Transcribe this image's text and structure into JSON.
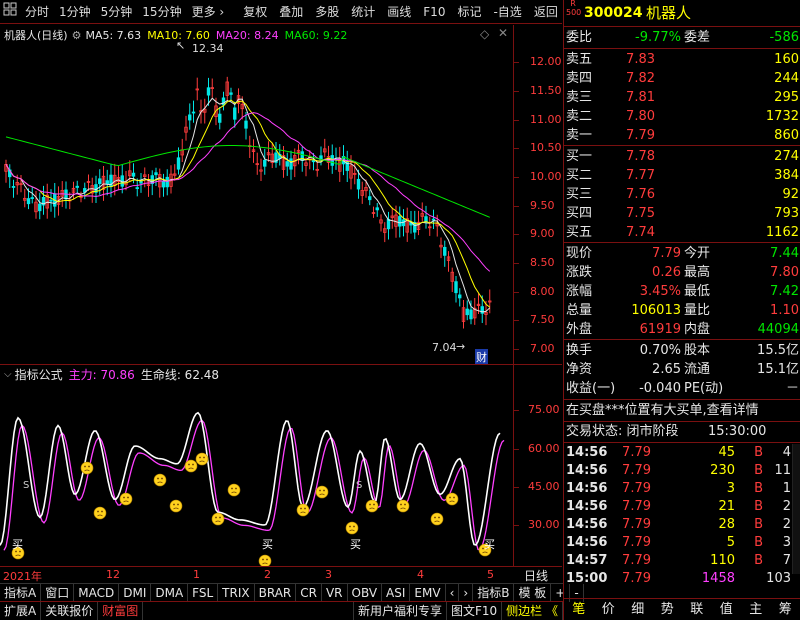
{
  "toolbar": {
    "left_items": [
      "分时",
      "1分钟",
      "5分钟",
      "15分钟",
      "更多 ›"
    ],
    "right_items": [
      "复权",
      "叠加",
      "多股",
      "统计",
      "画线",
      "F10",
      "标记",
      "-自选",
      "返回"
    ]
  },
  "stock": {
    "code": "300024",
    "name": "机器人",
    "badge_top": "R",
    "badge_bottom": "500"
  },
  "kline_header": {
    "title": "机器人(日线)",
    "ma5": "MA5: 7.63",
    "ma10": "MA10: 7.60",
    "ma20": "MA20: 8.24",
    "ma60": "MA60: 9.22",
    "high_label": "12.34",
    "low_label": "7.04",
    "cai_label": "财"
  },
  "price_axis": [
    "12.00",
    "11.50",
    "11.00",
    "10.50",
    "10.00",
    "9.50",
    "9.00",
    "8.50",
    "8.00",
    "7.50",
    "7.00"
  ],
  "indicator_header": {
    "name": "指标公式",
    "main": "主力: 70.86",
    "life": "生命线: 62.48"
  },
  "indicator_axis": [
    "75.00",
    "60.00",
    "45.00",
    "30.00"
  ],
  "indicator_markers": {
    "buy": "买",
    "sell": "S"
  },
  "date_axis": {
    "labels": [
      "2021年",
      "12",
      "1",
      "2",
      "3",
      "4",
      "5"
    ],
    "mode": "日线"
  },
  "bottom_tabs": [
    "指标A",
    "窗口",
    "MACD",
    "DMI",
    "DMA",
    "FSL",
    "TRIX",
    "BRAR",
    "CR",
    "VR",
    "OBV",
    "ASI",
    "EMV",
    "‹",
    "›",
    "指标B",
    "模 板",
    "+",
    "-"
  ],
  "footer_left": [
    "扩展A",
    "关联报价",
    "财富图"
  ],
  "footer_mid": [
    "新用户福利专享",
    "图文F10",
    "侧边栏 《"
  ],
  "quote": {
    "weibi_label": "委比",
    "weibi": "-9.77%",
    "weicha_label": "委差",
    "weicha": "-586",
    "asks": [
      {
        "label": "卖五",
        "price": "7.83",
        "vol": "160"
      },
      {
        "label": "卖四",
        "price": "7.82",
        "vol": "244"
      },
      {
        "label": "卖三",
        "price": "7.81",
        "vol": "295"
      },
      {
        "label": "卖二",
        "price": "7.80",
        "vol": "1732"
      },
      {
        "label": "卖一",
        "price": "7.79",
        "vol": "860"
      }
    ],
    "bids": [
      {
        "label": "买一",
        "price": "7.78",
        "vol": "274"
      },
      {
        "label": "买二",
        "price": "7.77",
        "vol": "384"
      },
      {
        "label": "买三",
        "price": "7.76",
        "vol": "92"
      },
      {
        "label": "买四",
        "price": "7.75",
        "vol": "793"
      },
      {
        "label": "买五",
        "price": "7.74",
        "vol": "1162"
      }
    ],
    "stats": [
      {
        "l1": "现价",
        "v1": "7.79",
        "c1": "red",
        "l2": "今开",
        "v2": "7.44",
        "c2": "green"
      },
      {
        "l1": "涨跌",
        "v1": "0.26",
        "c1": "red",
        "l2": "最高",
        "v2": "7.80",
        "c2": "red"
      },
      {
        "l1": "涨幅",
        "v1": "3.45%",
        "c1": "red",
        "l2": "最低",
        "v2": "7.42",
        "c2": "green"
      },
      {
        "l1": "总量",
        "v1": "106013",
        "c1": "yellow",
        "l2": "量比",
        "v2": "1.10",
        "c2": "red"
      },
      {
        "l1": "外盘",
        "v1": "61919",
        "c1": "red",
        "l2": "内盘",
        "v2": "44094",
        "c2": "green"
      }
    ],
    "stats2": [
      {
        "l1": "换手",
        "v1": "0.70%",
        "l2": "股本",
        "v2": "15.5亿"
      },
      {
        "l1": "净资",
        "v1": "2.65",
        "l2": "流通",
        "v2": "15.1亿"
      },
      {
        "l1": "收益(一)",
        "v1": "-0.040",
        "l2": "PE(动)",
        "v2": "－"
      }
    ],
    "notice": "在买盘***位置有大买单,查看详情",
    "status_label": "交易状态: 闭市阶段",
    "status_time": "15:30:00",
    "ticks": [
      {
        "t": "14:56",
        "p": "7.79",
        "v": "45",
        "d": "B",
        "n": "4"
      },
      {
        "t": "14:56",
        "p": "7.79",
        "v": "230",
        "d": "B",
        "n": "11"
      },
      {
        "t": "14:56",
        "p": "7.79",
        "v": "3",
        "d": "B",
        "n": "1"
      },
      {
        "t": "14:56",
        "p": "7.79",
        "v": "21",
        "d": "B",
        "n": "2"
      },
      {
        "t": "14:56",
        "p": "7.79",
        "v": "28",
        "d": "B",
        "n": "2"
      },
      {
        "t": "14:56",
        "p": "7.79",
        "v": "5",
        "d": "B",
        "n": "3"
      },
      {
        "t": "14:57",
        "p": "7.79",
        "v": "110",
        "d": "B",
        "n": "7"
      },
      {
        "t": "15:00",
        "p": "7.79",
        "v": "1458",
        "d": "",
        "n": "103"
      }
    ],
    "right_tabs": [
      "笔",
      "价",
      "细",
      "势",
      "联",
      "值",
      "主",
      "筹"
    ]
  },
  "colors": {
    "up": "#ff3c3c",
    "down": "#00e6e6",
    "frame": "#7a1010",
    "ma5": "#e6e6e6",
    "ma10": "#ffff00",
    "ma20": "#ff40ff",
    "ma60": "#00e600"
  }
}
